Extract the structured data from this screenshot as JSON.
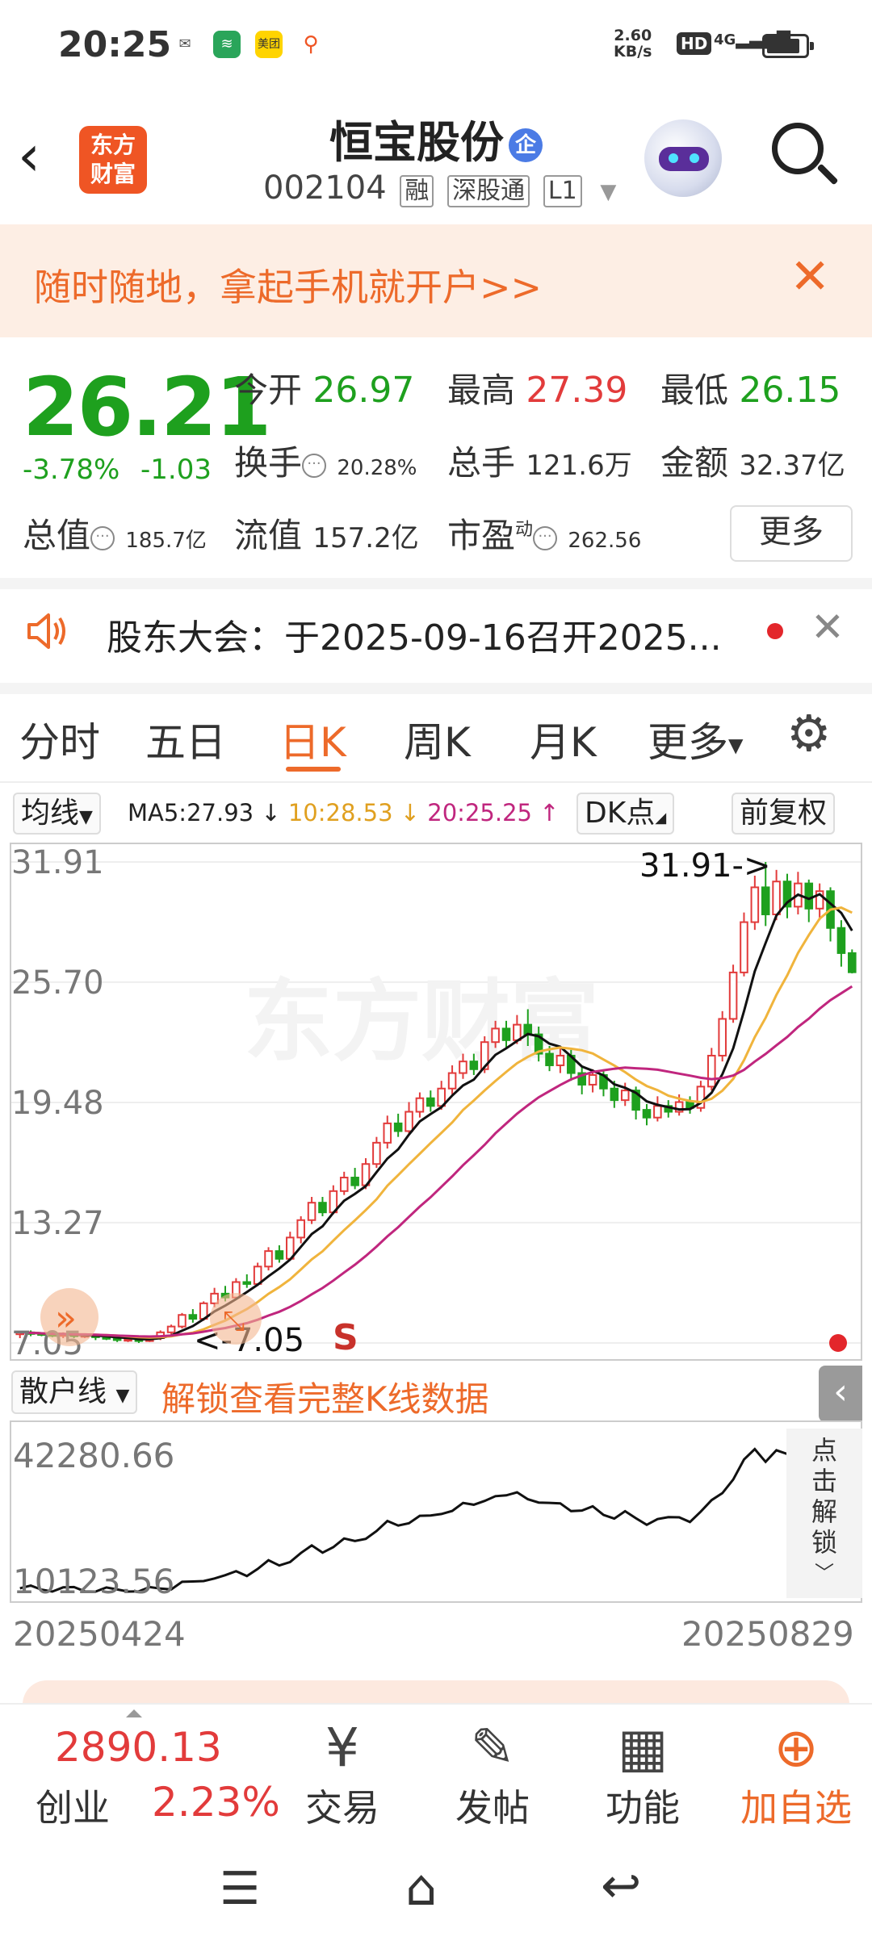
{
  "status_bar": {
    "time": "20:25",
    "speed_value": "2.60",
    "speed_unit": "KB/s",
    "hd": "HD",
    "network": "4G"
  },
  "header": {
    "logo_line1": "东方",
    "logo_line2": "财富",
    "stock_name": "恒宝股份",
    "badge": "企",
    "code": "002104",
    "tags": [
      "融",
      "深股通",
      "L1"
    ]
  },
  "banner": {
    "text": "随时随地，拿起手机就开户>>"
  },
  "quote": {
    "price": "26.21",
    "change_pct": "-3.78%",
    "change": "-1.03",
    "open_label": "今开",
    "open": "26.97",
    "high_label": "最高",
    "high": "27.39",
    "low_label": "最低",
    "low": "26.15",
    "turnover_label": "换手",
    "turnover": "20.28%",
    "volume_label": "总手",
    "volume": "121.6万",
    "amount_label": "金额",
    "amount": "32.37亿",
    "mcap_label": "总值",
    "mcap": "185.7亿",
    "float_label": "流值",
    "float": "157.2亿",
    "pe_label": "市盈",
    "pe_sup": "动",
    "pe": "262.56",
    "more": "更多"
  },
  "notice": {
    "text": "股东大会：于2025-09-16召开2025..."
  },
  "tabs": [
    "分时",
    "五日",
    "日K",
    "周K",
    "月K",
    "更多"
  ],
  "active_tab": "日K",
  "indicator": {
    "select": "均线",
    "ma5": "MA5:27.93 ↓",
    "ma10": "10:28.53 ↓",
    "ma20": "20:25.25 ↑",
    "dk": "DK点",
    "adjust": "前复权"
  },
  "kline": {
    "y_labels": [
      "31.91",
      "25.70",
      "19.48",
      "13.27",
      "7.05"
    ],
    "high_label": "31.91->",
    "low_label": "<-7.05",
    "signal": "S"
  },
  "sub_chart": {
    "select": "散户线",
    "unlock": "解锁查看完整K线数据",
    "y_top": "42280.66",
    "y_bottom": "10123.56",
    "side_text": [
      "点",
      "击",
      "解",
      "锁"
    ]
  },
  "dates": {
    "start": "20250424",
    "end": "20250829"
  },
  "bottom_nav": {
    "index_value": "2890.13",
    "index_name": "创业",
    "index_pct": "2.23%",
    "items": [
      "交易",
      "发帖",
      "功能",
      "加自选"
    ]
  },
  "colors": {
    "up": "#e23b3b",
    "down": "#1ea01e",
    "accent": "#ed6a2a",
    "ma5": "#111111",
    "ma10": "#f0b43c",
    "ma20": "#c0267e"
  },
  "chart_data": {
    "type": "candlestick",
    "y_range": [
      7.05,
      31.91
    ],
    "candles": [
      [
        7.5,
        7.6,
        7.3,
        7.6
      ],
      [
        7.6,
        7.55,
        7.4,
        7.7
      ],
      [
        7.55,
        7.5,
        7.4,
        7.6
      ],
      [
        7.5,
        7.45,
        7.35,
        7.6
      ],
      [
        7.45,
        7.5,
        7.3,
        7.6
      ],
      [
        7.5,
        7.4,
        7.3,
        7.55
      ],
      [
        7.4,
        7.45,
        7.3,
        7.5
      ],
      [
        7.45,
        7.35,
        7.2,
        7.5
      ],
      [
        7.35,
        7.3,
        7.2,
        7.45
      ],
      [
        7.3,
        7.2,
        7.1,
        7.35
      ],
      [
        7.2,
        7.25,
        7.1,
        7.3
      ],
      [
        7.25,
        7.15,
        7.05,
        7.3
      ],
      [
        7.15,
        7.3,
        7.1,
        7.4
      ],
      [
        7.3,
        7.6,
        7.2,
        7.7
      ],
      [
        7.6,
        7.9,
        7.5,
        8.0
      ],
      [
        7.9,
        8.5,
        7.8,
        8.6
      ],
      [
        8.5,
        8.3,
        8.1,
        8.8
      ],
      [
        8.3,
        9.1,
        8.2,
        9.2
      ],
      [
        9.1,
        9.6,
        8.9,
        9.9
      ],
      [
        9.6,
        9.4,
        9.2,
        10.0
      ],
      [
        9.4,
        10.2,
        9.3,
        10.4
      ],
      [
        10.2,
        10.1,
        9.9,
        10.6
      ],
      [
        10.1,
        11.0,
        10.0,
        11.2
      ],
      [
        11.0,
        11.8,
        10.8,
        12.0
      ],
      [
        11.8,
        11.4,
        11.2,
        12.1
      ],
      [
        11.4,
        12.5,
        11.3,
        12.8
      ],
      [
        12.5,
        13.4,
        12.2,
        13.6
      ],
      [
        13.4,
        14.3,
        13.2,
        14.6
      ],
      [
        14.3,
        13.8,
        13.6,
        14.6
      ],
      [
        13.8,
        14.9,
        13.7,
        15.2
      ],
      [
        14.9,
        15.6,
        14.7,
        15.9
      ],
      [
        15.6,
        15.2,
        15.0,
        16.1
      ],
      [
        15.2,
        16.3,
        15.0,
        16.6
      ],
      [
        16.3,
        17.4,
        16.1,
        17.7
      ],
      [
        17.4,
        18.4,
        17.1,
        18.8
      ],
      [
        18.4,
        18.0,
        17.7,
        18.9
      ],
      [
        18.0,
        19.0,
        17.8,
        19.5
      ],
      [
        19.0,
        19.7,
        18.7,
        20.0
      ],
      [
        19.7,
        19.3,
        19.0,
        20.1
      ],
      [
        19.3,
        20.2,
        19.1,
        20.6
      ],
      [
        20.2,
        21.0,
        19.9,
        21.4
      ],
      [
        21.0,
        21.6,
        20.7,
        22.0
      ],
      [
        21.6,
        21.2,
        20.9,
        22.0
      ],
      [
        21.2,
        22.6,
        21.0,
        22.9
      ],
      [
        22.6,
        23.3,
        22.3,
        23.7
      ],
      [
        23.3,
        22.7,
        22.3,
        23.7
      ],
      [
        22.7,
        23.5,
        22.5,
        24.0
      ],
      [
        23.5,
        23.0,
        22.4,
        24.3
      ],
      [
        23.0,
        22.0,
        21.6,
        23.4
      ],
      [
        22.0,
        21.4,
        21.1,
        22.4
      ],
      [
        21.4,
        21.9,
        21.0,
        22.3
      ],
      [
        21.9,
        21.0,
        20.6,
        22.2
      ],
      [
        21.0,
        20.4,
        19.9,
        21.3
      ],
      [
        20.4,
        20.9,
        20.0,
        21.2
      ],
      [
        20.9,
        20.2,
        19.8,
        21.1
      ],
      [
        20.2,
        19.6,
        19.2,
        20.6
      ],
      [
        19.6,
        20.1,
        19.3,
        20.5
      ],
      [
        20.1,
        19.1,
        18.6,
        20.3
      ],
      [
        19.1,
        18.7,
        18.3,
        19.4
      ],
      [
        18.7,
        19.3,
        18.5,
        19.8
      ],
      [
        19.3,
        19.0,
        18.7,
        19.6
      ],
      [
        19.0,
        19.5,
        18.8,
        19.9
      ],
      [
        19.5,
        19.2,
        18.9,
        19.8
      ],
      [
        19.2,
        20.3,
        19.0,
        20.6
      ],
      [
        20.3,
        21.9,
        20.1,
        22.3
      ],
      [
        21.9,
        23.8,
        21.6,
        24.2
      ],
      [
        23.8,
        26.2,
        23.6,
        26.6
      ],
      [
        26.2,
        28.8,
        26.0,
        29.3
      ],
      [
        28.8,
        30.6,
        28.4,
        31.2
      ],
      [
        30.6,
        29.2,
        28.6,
        31.91
      ],
      [
        29.2,
        30.9,
        28.9,
        31.5
      ],
      [
        30.9,
        29.6,
        29.0,
        31.3
      ],
      [
        29.6,
        30.8,
        29.2,
        31.4
      ],
      [
        30.8,
        29.5,
        28.8,
        31.0
      ],
      [
        29.5,
        30.4,
        28.9,
        30.8
      ],
      [
        30.4,
        28.5,
        27.8,
        30.6
      ],
      [
        28.5,
        27.2,
        26.5,
        28.9
      ],
      [
        27.2,
        26.21,
        26.15,
        27.39
      ]
    ],
    "ma5_last": 27.93,
    "ma10_last": 28.53,
    "ma20_last": 25.25,
    "sub_series_range": [
      10123.56,
      42280.66
    ]
  }
}
